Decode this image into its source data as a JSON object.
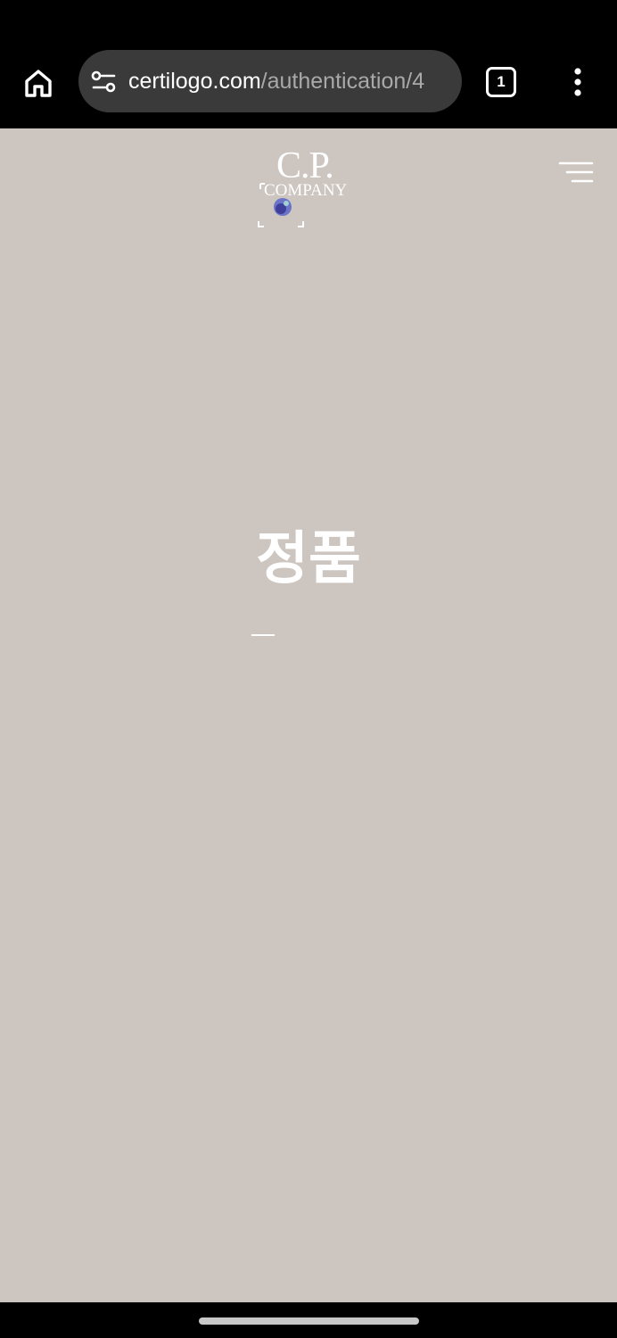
{
  "browser": {
    "url_domain": "certilogo.com",
    "url_path": "/authentication/4",
    "tab_count": "1",
    "icons": {
      "home": "home-icon",
      "site_settings": "tune-icon",
      "menu": "more-vert-icon"
    }
  },
  "header": {
    "logo_line1": "C.P.",
    "logo_line2": "COMPANY",
    "menu_icon": "hamburger-icon"
  },
  "main": {
    "status_title": "정품"
  },
  "colors": {
    "page_background": "#cdc5bf",
    "text": "#ffffff",
    "browser_chrome": "#000000",
    "url_pill": "#3a3a3a"
  }
}
